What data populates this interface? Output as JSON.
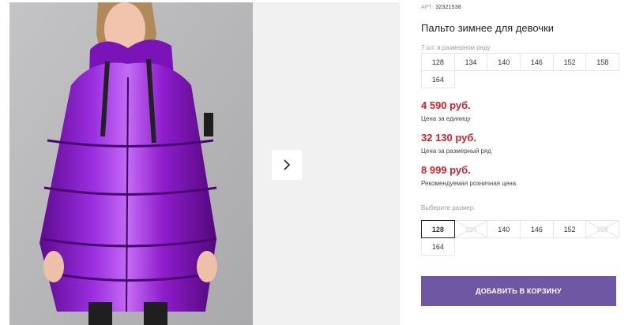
{
  "product": {
    "art_label": "АРТ:",
    "art_value": "32321538",
    "title": "Пальто зимнее для девочки"
  },
  "size_row": {
    "label": "7 шт. в размерном ряду",
    "sizes": [
      "128",
      "134",
      "140",
      "146",
      "152",
      "158",
      "164"
    ]
  },
  "prices": [
    {
      "value": "4 590 руб.",
      "label": "Цена за единицу"
    },
    {
      "value": "32 130 руб.",
      "label": "Цена за размерный ряд"
    },
    {
      "value": "8 999 руб.",
      "label": "Рекомендуемая розничная цена"
    }
  ],
  "choose_size": {
    "label": "Выберите размер:",
    "sizes": [
      {
        "size": "128",
        "state": "selected"
      },
      {
        "size": "134",
        "state": "disabled"
      },
      {
        "size": "140",
        "state": "available"
      },
      {
        "size": "146",
        "state": "available"
      },
      {
        "size": "152",
        "state": "available"
      },
      {
        "size": "158",
        "state": "disabled"
      },
      {
        "size": "164",
        "state": "available"
      }
    ]
  },
  "cart_button": "ДОБАВИТЬ В КОРЗИНУ",
  "icons": {
    "next": "chevron-right-icon"
  },
  "colors": {
    "price": "#d0232a",
    "button": "#6e57a3",
    "coat": "#8e1ccc"
  }
}
